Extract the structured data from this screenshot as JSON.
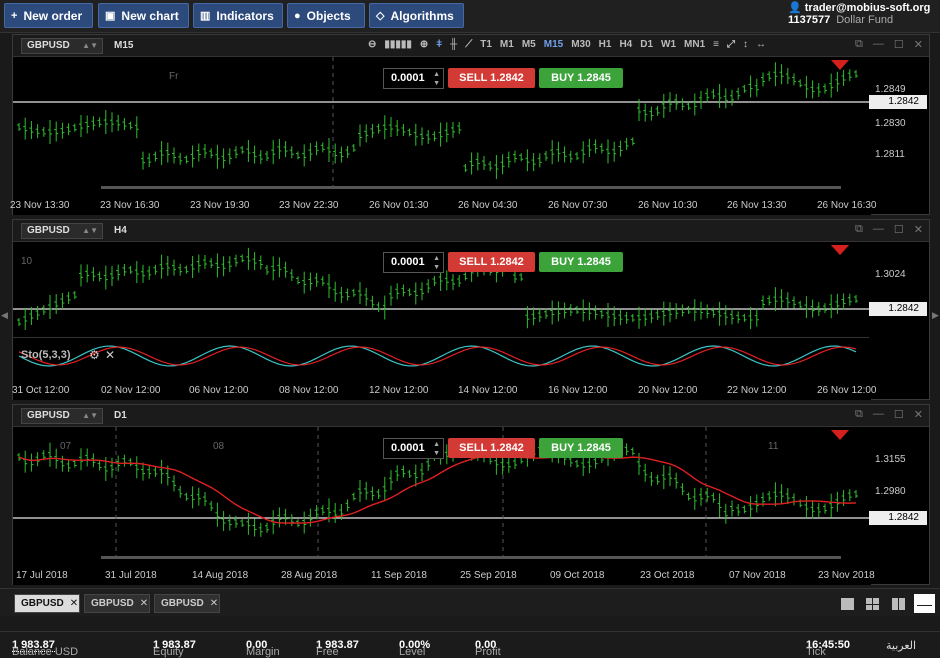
{
  "toolbar": {
    "new_order": "New order",
    "new_chart": "New chart",
    "indicators": "Indicators",
    "objects": "Objects",
    "algorithms": "Algorithms"
  },
  "account": {
    "user": "trader@mobius-soft.org",
    "number": "1137577",
    "fund": "Dollar Fund"
  },
  "trade": {
    "lot": "0.0001",
    "sell": "SELL",
    "sell_price": "1.2842",
    "buy": "BUY",
    "buy_price": "1.2845"
  },
  "timeframes": [
    "T1",
    "M1",
    "M5",
    "M15",
    "M30",
    "H1",
    "H4",
    "D1",
    "W1",
    "MN1"
  ],
  "charts": [
    {
      "symbol": "GBPUSD",
      "tf": "M15",
      "marker": "Fr",
      "price": "1.2842",
      "ticks": [
        "1.2849",
        "1.2830",
        "1.2811"
      ],
      "dates": [
        "23 Nov 13:30",
        "23 Nov 16:30",
        "23 Nov 19:30",
        "23 Nov 22:30",
        "26 Nov 01:30",
        "26 Nov 04:30",
        "26 Nov 07:30",
        "26 Nov 10:30",
        "26 Nov 13:30",
        "26 Nov 16:30"
      ]
    },
    {
      "symbol": "GBPUSD",
      "tf": "H4",
      "marker": "10",
      "price": "1.2842",
      "indicator": "Sto(5,3,3)",
      "ticks": [
        "1.3024"
      ],
      "dates": [
        "31 Oct 12:00",
        "02 Nov 12:00",
        "06 Nov 12:00",
        "08 Nov 12:00",
        "12 Nov 12:00",
        "14 Nov 12:00",
        "16 Nov 12:00",
        "20 Nov 12:00",
        "22 Nov 12:00",
        "26 Nov 12:00"
      ]
    },
    {
      "symbol": "GBPUSD",
      "tf": "D1",
      "markers": [
        "07",
        "08",
        "11"
      ],
      "price": "1.2842",
      "ticks": [
        "1.3155",
        "1.2980"
      ],
      "dates": [
        "17 Jul 2018",
        "31 Jul 2018",
        "14 Aug 2018",
        "28 Aug 2018",
        "11 Sep 2018",
        "25 Sep 2018",
        "09 Oct 2018",
        "23 Oct 2018",
        "07 Nov 2018",
        "23 Nov 2018"
      ]
    }
  ],
  "tabs": [
    {
      "label": "GBPUSD"
    },
    {
      "label": "GBPUSD"
    },
    {
      "label": "GBPUSD"
    }
  ],
  "status": {
    "balance_label": "Balance",
    "balance": "1 983.87",
    "currency": "USD",
    "equity_label": "Equity",
    "equity": "1 983.87",
    "margin_label": "Margin",
    "margin": "0.00",
    "free_label": "Free",
    "free": "1 983.87",
    "level_label": "Level",
    "level": "0.00%",
    "profit_label": "Profit",
    "profit": "0.00",
    "tick_label": "Tick",
    "time": "16:45:50",
    "lang": "العربية"
  },
  "colors": {
    "bull": "#2fbf2f",
    "sell": "#d43a35",
    "buy": "#3ca23a",
    "ma": "#e02020",
    "sto_k": "#3cc4c4",
    "sto_d": "#e02020"
  }
}
